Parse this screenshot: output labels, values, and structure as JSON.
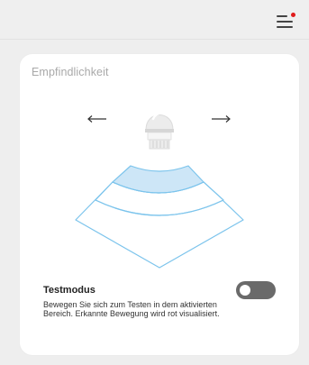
{
  "header": {
    "menu_icon": "hamburger-menu-icon",
    "notification_color": "#e01b1b"
  },
  "sensitivity": {
    "title": "Empfindlichkeit",
    "decrease_icon": "arrow-left-icon",
    "increase_icon": "arrow-right-icon",
    "sensor_icon": "motion-sensor-icon",
    "zones_total": 3,
    "zones_active": 1,
    "active_color": "#cde6f7",
    "outline_color": "#7cc4ec"
  },
  "test_mode": {
    "label": "Testmodus",
    "description": "Bewegen Sie sich zum Testen in dem aktivierten Bereich. Erkannte Bewegung wird rot visualisiert.",
    "enabled": false
  }
}
